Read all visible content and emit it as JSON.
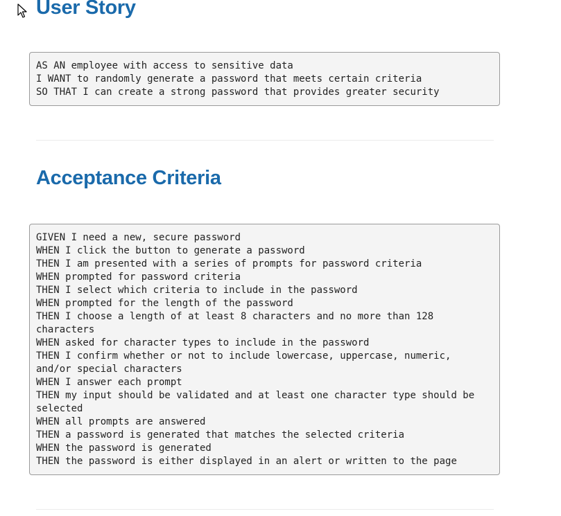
{
  "sections": {
    "user_story": {
      "heading": "User Story",
      "code": "AS AN employee with access to sensitive data\nI WANT to randomly generate a password that meets certain criteria\nSO THAT I can create a strong password that provides greater security"
    },
    "acceptance_criteria": {
      "heading": "Acceptance Criteria",
      "code": "GIVEN I need a new, secure password\nWHEN I click the button to generate a password\nTHEN I am presented with a series of prompts for password criteria\nWHEN prompted for password criteria\nTHEN I select which criteria to include in the password\nWHEN prompted for the length of the password\nTHEN I choose a length of at least 8 characters and no more than 128\ncharacters\nWHEN asked for character types to include in the password\nTHEN I confirm whether or not to include lowercase, uppercase, numeric,\nand/or special characters\nWHEN I answer each prompt\nTHEN my input should be validated and at least one character type should be\nselected\nWHEN all prompts are answered\nTHEN a password is generated that matches the selected criteria\nWHEN the password is generated\nTHEN the password is either displayed in an alert or written to the page"
    }
  },
  "icons": {
    "cursor": "mouse-pointer-icon"
  },
  "colors": {
    "heading": "#1a6aab",
    "code_background": "#f4f4f4",
    "code_border": "#9a9a9a",
    "code_text": "#222222",
    "divider": "#ececec"
  }
}
